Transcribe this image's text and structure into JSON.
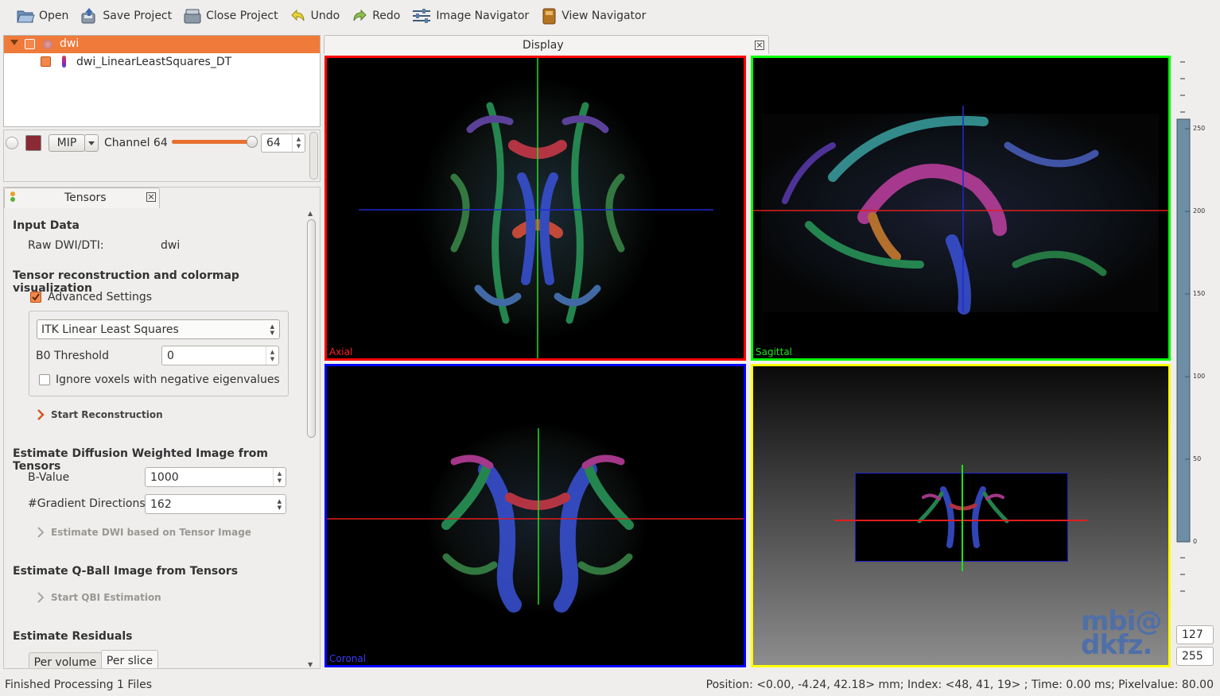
{
  "toolbar": {
    "open": "Open",
    "save_project": "Save Project",
    "close_project": "Close Project",
    "undo": "Undo",
    "redo": "Redo",
    "image_navigator": "Image Navigator",
    "view_navigator": "View Navigator"
  },
  "datamanager": {
    "items": [
      {
        "label": "dwi",
        "selected": true
      },
      {
        "label": "dwi_LinearLeastSquares_DT",
        "selected": false
      }
    ]
  },
  "properties": {
    "render_mode": "MIP",
    "channel_label": "Channel 64",
    "channel_value": "64",
    "channel_fraction": 0.98
  },
  "tensors": {
    "tab_label": "Tensors",
    "input_data_title": "Input Data",
    "raw_label": "Raw DWI/DTI:",
    "raw_value": "dwi",
    "recon_title": "Tensor reconstruction and colormap visualization",
    "advanced_settings": "Advanced Settings",
    "advanced_checked": true,
    "method": "ITK Linear Least Squares",
    "b0_label": "B0 Threshold",
    "b0_value": "0",
    "ignore_label": "Ignore voxels with negative eigenvalues",
    "ignore_checked": false,
    "start_recon": "Start Reconstruction",
    "dwi_title": "Estimate Diffusion Weighted Image from Tensors",
    "bvalue_label": "B-Value",
    "bvalue": "1000",
    "graddir_label": "#Gradient Directions",
    "graddir": "162",
    "estimate_dwi": "Estimate DWI based on Tensor Image",
    "qball_title": "Estimate Q-Ball Image from Tensors",
    "start_qbi": "Start QBI Estimation",
    "residuals_title": "Estimate Residuals",
    "per_volume": "Per volume",
    "per_slice": "Per slice"
  },
  "display": {
    "tab_label": "Display",
    "views": {
      "axial": "Axial",
      "sagittal": "Sagittal",
      "coronal": "Coronal"
    },
    "colors": {
      "axial": "#ff0000",
      "sagittal": "#00ff00",
      "coronal": "#0000ff",
      "threed": "#ffff00"
    },
    "logo_line1": "mbi@",
    "logo_line2": "dkfz."
  },
  "levelwindow": {
    "ticks": [
      "250",
      "200",
      "150",
      "100",
      "50",
      "0"
    ],
    "level": "127",
    "window": "255"
  },
  "status": {
    "left": "Finished Processing 1 Files",
    "right": "Position: <0.00, -4.24, 42.18> mm; Index: <48, 41, 19> ; Time: 0.00 ms; Pixelvalue: 80.00"
  }
}
